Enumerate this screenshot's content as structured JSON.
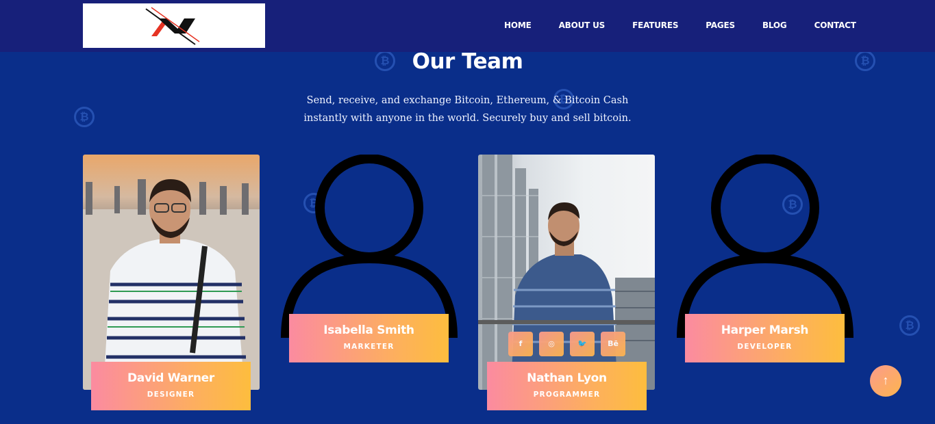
{
  "nav": {
    "items": [
      "HOME",
      "ABOUT US",
      "FEATURES",
      "PAGES",
      "BLOG",
      "CONTACT"
    ]
  },
  "section": {
    "title": "Our Team",
    "description": "Send, receive, and exchange Bitcoin, Ethereum, & Bitcoin Cash instantly with anyone in the world. Securely buy and sell bitcoin."
  },
  "team": [
    {
      "name": "David Warner",
      "role": "DESIGNER",
      "image": "photo"
    },
    {
      "name": "Isabella Smith",
      "role": "MARKETER",
      "image": "user-icon"
    },
    {
      "name": "Nathan Lyon",
      "role": "PROGRAMMER",
      "image": "photo"
    },
    {
      "name": "Harper Marsh",
      "role": "DEVELOPER",
      "image": "user-icon"
    }
  ],
  "socials": [
    {
      "icon": "facebook-icon",
      "glyph": "f"
    },
    {
      "icon": "instagram-icon",
      "glyph": "◎"
    },
    {
      "icon": "twitter-icon",
      "glyph": "🐦"
    },
    {
      "icon": "behance-icon",
      "glyph": "Bē"
    }
  ],
  "scroll_top": {
    "icon": "arrow-up-icon",
    "glyph": "↑"
  },
  "colors": {
    "page_bg": "#0a2e8a",
    "nav_bg": "#17207a",
    "accent_gradient_start": "#fb8ba0",
    "accent_gradient_end": "#fdbd3e"
  }
}
